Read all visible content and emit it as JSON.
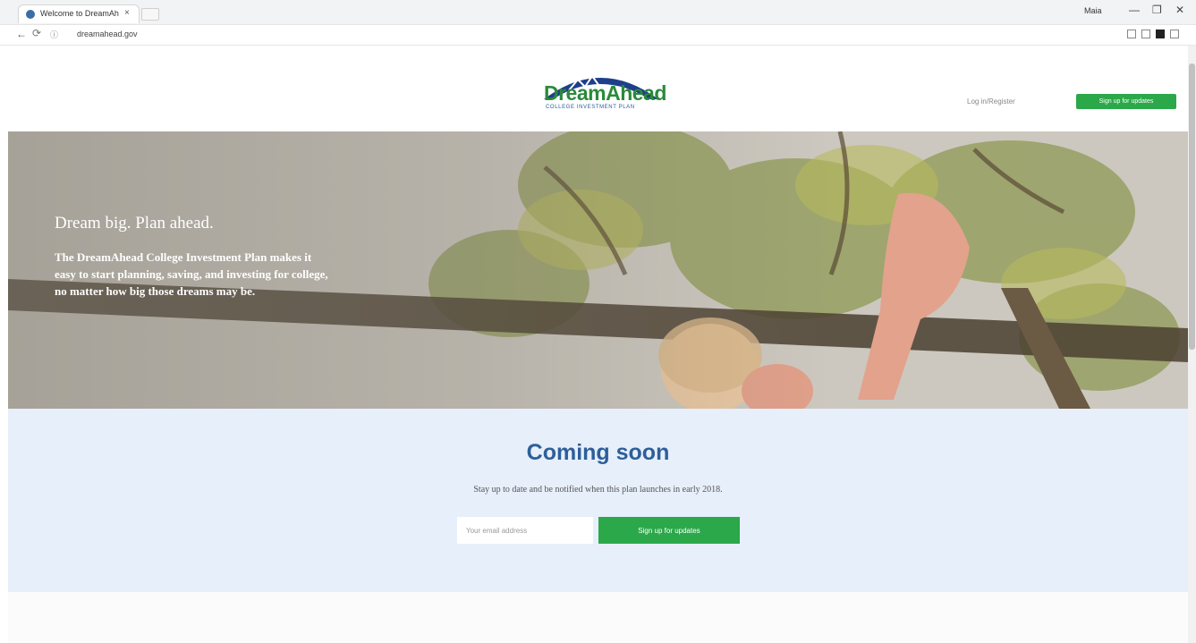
{
  "browser": {
    "tab_title": "Welcome to DreamAhead",
    "tab_close": "×",
    "user_label": "Maia",
    "minimize": "—",
    "maximize": "❐",
    "close": "✕",
    "back": "←",
    "reload": "⟳",
    "url_prefix": "ⓘ",
    "url": "dreamahead.gov"
  },
  "header": {
    "logo_text": "DreamAhead",
    "logo_sub": "COLLEGE INVESTMENT PLAN",
    "login_label": "Log in/Register",
    "signup_label": "Sign up for updates"
  },
  "hero": {
    "heading": "Dream big. Plan ahead.",
    "body": "The DreamAhead College Investment Plan makes it easy to start planning, saving, and investing for college, no matter how big those dreams may be."
  },
  "coming_soon": {
    "title": "Coming soon",
    "subtitle": "Stay up to date and be notified when this plan launches in early 2018.",
    "email_placeholder": "Your email address",
    "button_label": "Sign up for updates"
  },
  "colors": {
    "brand_green": "#2ba84a",
    "brand_blue": "#2d5f9a",
    "coming_bg": "#e7effa"
  }
}
